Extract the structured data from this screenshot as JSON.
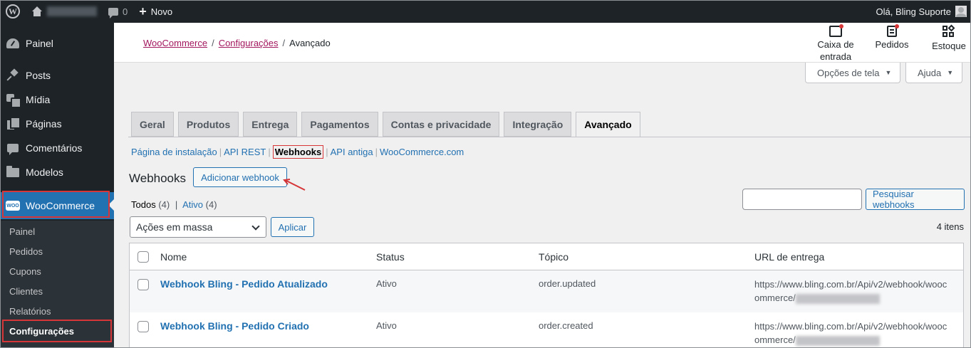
{
  "admin_bar": {
    "comments_count": "0",
    "new_label": "Novo",
    "greeting": "Olá, Bling Suporte"
  },
  "sidebar": {
    "items": [
      {
        "label": "Painel",
        "icon": "dashboard-icon"
      },
      {
        "label": "Posts",
        "icon": "pin-icon"
      },
      {
        "label": "Mídia",
        "icon": "media-icon"
      },
      {
        "label": "Páginas",
        "icon": "pages-icon"
      },
      {
        "label": "Comentários",
        "icon": "comments-icon"
      },
      {
        "label": "Modelos",
        "icon": "folder-icon"
      }
    ],
    "woocommerce": {
      "label": "WooCommerce",
      "icon_text": "WOO"
    },
    "submenu": [
      "Painel",
      "Pedidos",
      "Cupons",
      "Clientes",
      "Relatórios",
      "Configurações"
    ]
  },
  "header": {
    "breadcrumb": {
      "link1": "WooCommerce",
      "link2": "Configurações",
      "current": "Avançado",
      "sep": "/"
    },
    "actions": {
      "inbox_line1": "Caixa de",
      "inbox_line2": "entrada",
      "orders": "Pedidos",
      "stock": "Estoque"
    },
    "screen_options": "Opções de tela",
    "help": "Ajuda"
  },
  "tabs": [
    "Geral",
    "Produtos",
    "Entrega",
    "Pagamentos",
    "Contas e privacidade",
    "Integração",
    "Avançado"
  ],
  "subsections": {
    "install": "Página de instalação",
    "api_rest": "API REST",
    "webhooks": "Webhooks",
    "api_legacy": "API antiga",
    "woocom": "WooCommerce.com",
    "separator": "|"
  },
  "page": {
    "title": "Webhooks",
    "add_button": "Adicionar webhook",
    "status_all": "Todos",
    "status_all_count": "(4)",
    "status_active": "Ativo",
    "status_active_count": "(4)",
    "status_sep": "|",
    "search_button": "Pesquisar webhooks",
    "bulk_actions": "Ações em massa",
    "apply_button": "Aplicar",
    "items_count": "4 itens"
  },
  "table": {
    "columns": {
      "name": "Nome",
      "status": "Status",
      "topic": "Tópico",
      "url": "URL de entrega"
    },
    "rows": [
      {
        "name": "Webhook Bling - Pedido Atualizado",
        "status": "Ativo",
        "topic": "order.updated",
        "url_line1": "https://www.bling.com.br/Api/v2/webhook/wooc",
        "url_line2": "ommerce/"
      },
      {
        "name": "Webhook Bling - Pedido Criado",
        "status": "Ativo",
        "topic": "order.created",
        "url_line1": "https://www.bling.com.br/Api/v2/webhook/wooc",
        "url_line2": "ommerce/"
      }
    ]
  },
  "colors": {
    "accent": "#2271b1",
    "admin_dark": "#1d2327",
    "highlight_red": "#d63638",
    "breadcrumb_link": "#a2165d"
  }
}
